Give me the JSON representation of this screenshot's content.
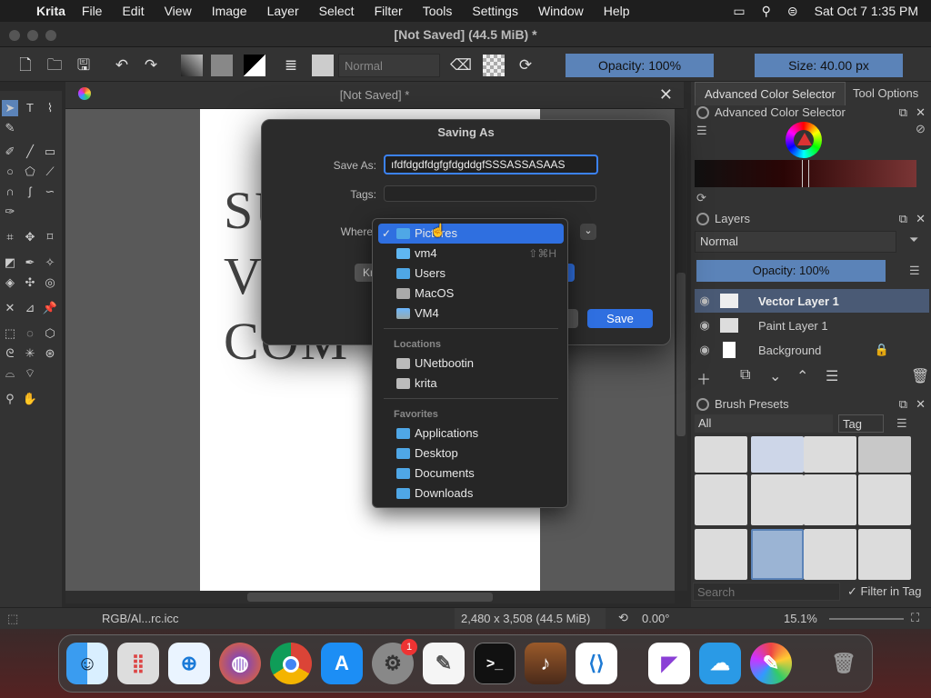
{
  "menubar": {
    "app_name": "Krita",
    "items": [
      "File",
      "Edit",
      "View",
      "Image",
      "Layer",
      "Select",
      "Filter",
      "Tools",
      "Settings",
      "Window",
      "Help"
    ],
    "clock": "Sat Oct 7  1:35 PM"
  },
  "window": {
    "title": "[Not Saved]  (44.5 MiB)  *"
  },
  "toolbar": {
    "blend_mode": "Normal",
    "opacity": "Opacity: 100%",
    "size": "Size: 40.00 px"
  },
  "document": {
    "tab_title": "[Not Saved]  *",
    "canvas_text": [
      "SU",
      "V",
      "COM"
    ]
  },
  "docker": {
    "tabs": [
      "Advanced Color Selector",
      "Tool Options"
    ],
    "color_selector_title": "Advanced Color Selector",
    "layers_title": "Layers",
    "layers_blend": "Normal",
    "layers_opacity": "Opacity:  100%",
    "layers": [
      {
        "name": "Vector Layer 1",
        "active": true
      },
      {
        "name": "Paint Layer 1",
        "active": false
      },
      {
        "name": "Background",
        "active": false
      }
    ],
    "brush_presets_title": "Brush Presets",
    "brush_filter": "All",
    "tag_label": "Tag",
    "search_placeholder": "Search",
    "filter_in_tag": "Filter in Tag"
  },
  "statusbar": {
    "color_profile": "RGB/Al...rc.icc",
    "dimensions": "2,480 x 3,508 (44.5 MiB)",
    "rotation": "0.00°",
    "zoom": "15.1%"
  },
  "dialog": {
    "title": "Saving As",
    "save_as_label": "Save As:",
    "filename": "ıfdfdgdfdgfgfdgddgfSSSASSASAAS",
    "tags_label": "Tags:",
    "where_label": "Where",
    "save_button": "Save",
    "hidden_button_fragment": "Kr"
  },
  "where_menu": {
    "items": [
      {
        "label": "Pictures",
        "selected": true
      },
      {
        "label": "vm4",
        "shortcut": "⇧⌘H"
      },
      {
        "label": "Users"
      },
      {
        "label": "MacOS"
      },
      {
        "label": "VM4"
      }
    ],
    "locations_header": "Locations",
    "locations": [
      "UNetbootin",
      "krita"
    ],
    "favorites_header": "Favorites",
    "favorites": [
      "Applications",
      "Desktop",
      "Documents",
      "Downloads"
    ]
  },
  "dock": {
    "badge": "1"
  }
}
